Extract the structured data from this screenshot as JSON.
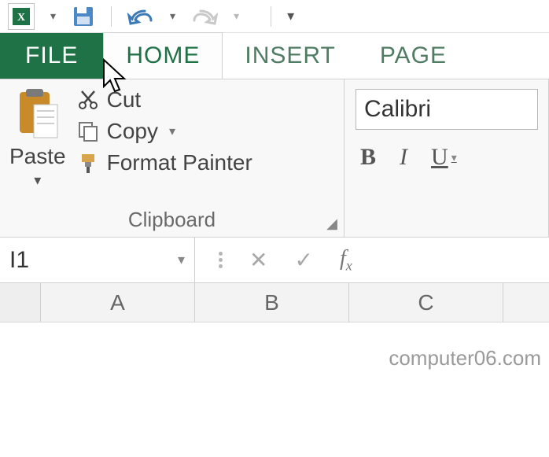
{
  "qat": {
    "excel_letter": "X"
  },
  "tabs": {
    "file": "FILE",
    "home": "HOME",
    "insert": "INSERT",
    "page": "PAGE"
  },
  "clipboard": {
    "paste": "Paste",
    "cut": "Cut",
    "copy": "Copy",
    "format_painter": "Format Painter",
    "group_label": "Clipboard"
  },
  "font": {
    "name": "Calibri",
    "bold": "B",
    "italic": "I",
    "underline": "U"
  },
  "namebox": {
    "value": "I1"
  },
  "formula": {
    "fx": "f",
    "fx_sub": "x"
  },
  "columns": [
    "A",
    "B",
    "C"
  ],
  "watermark": "computer06.com"
}
